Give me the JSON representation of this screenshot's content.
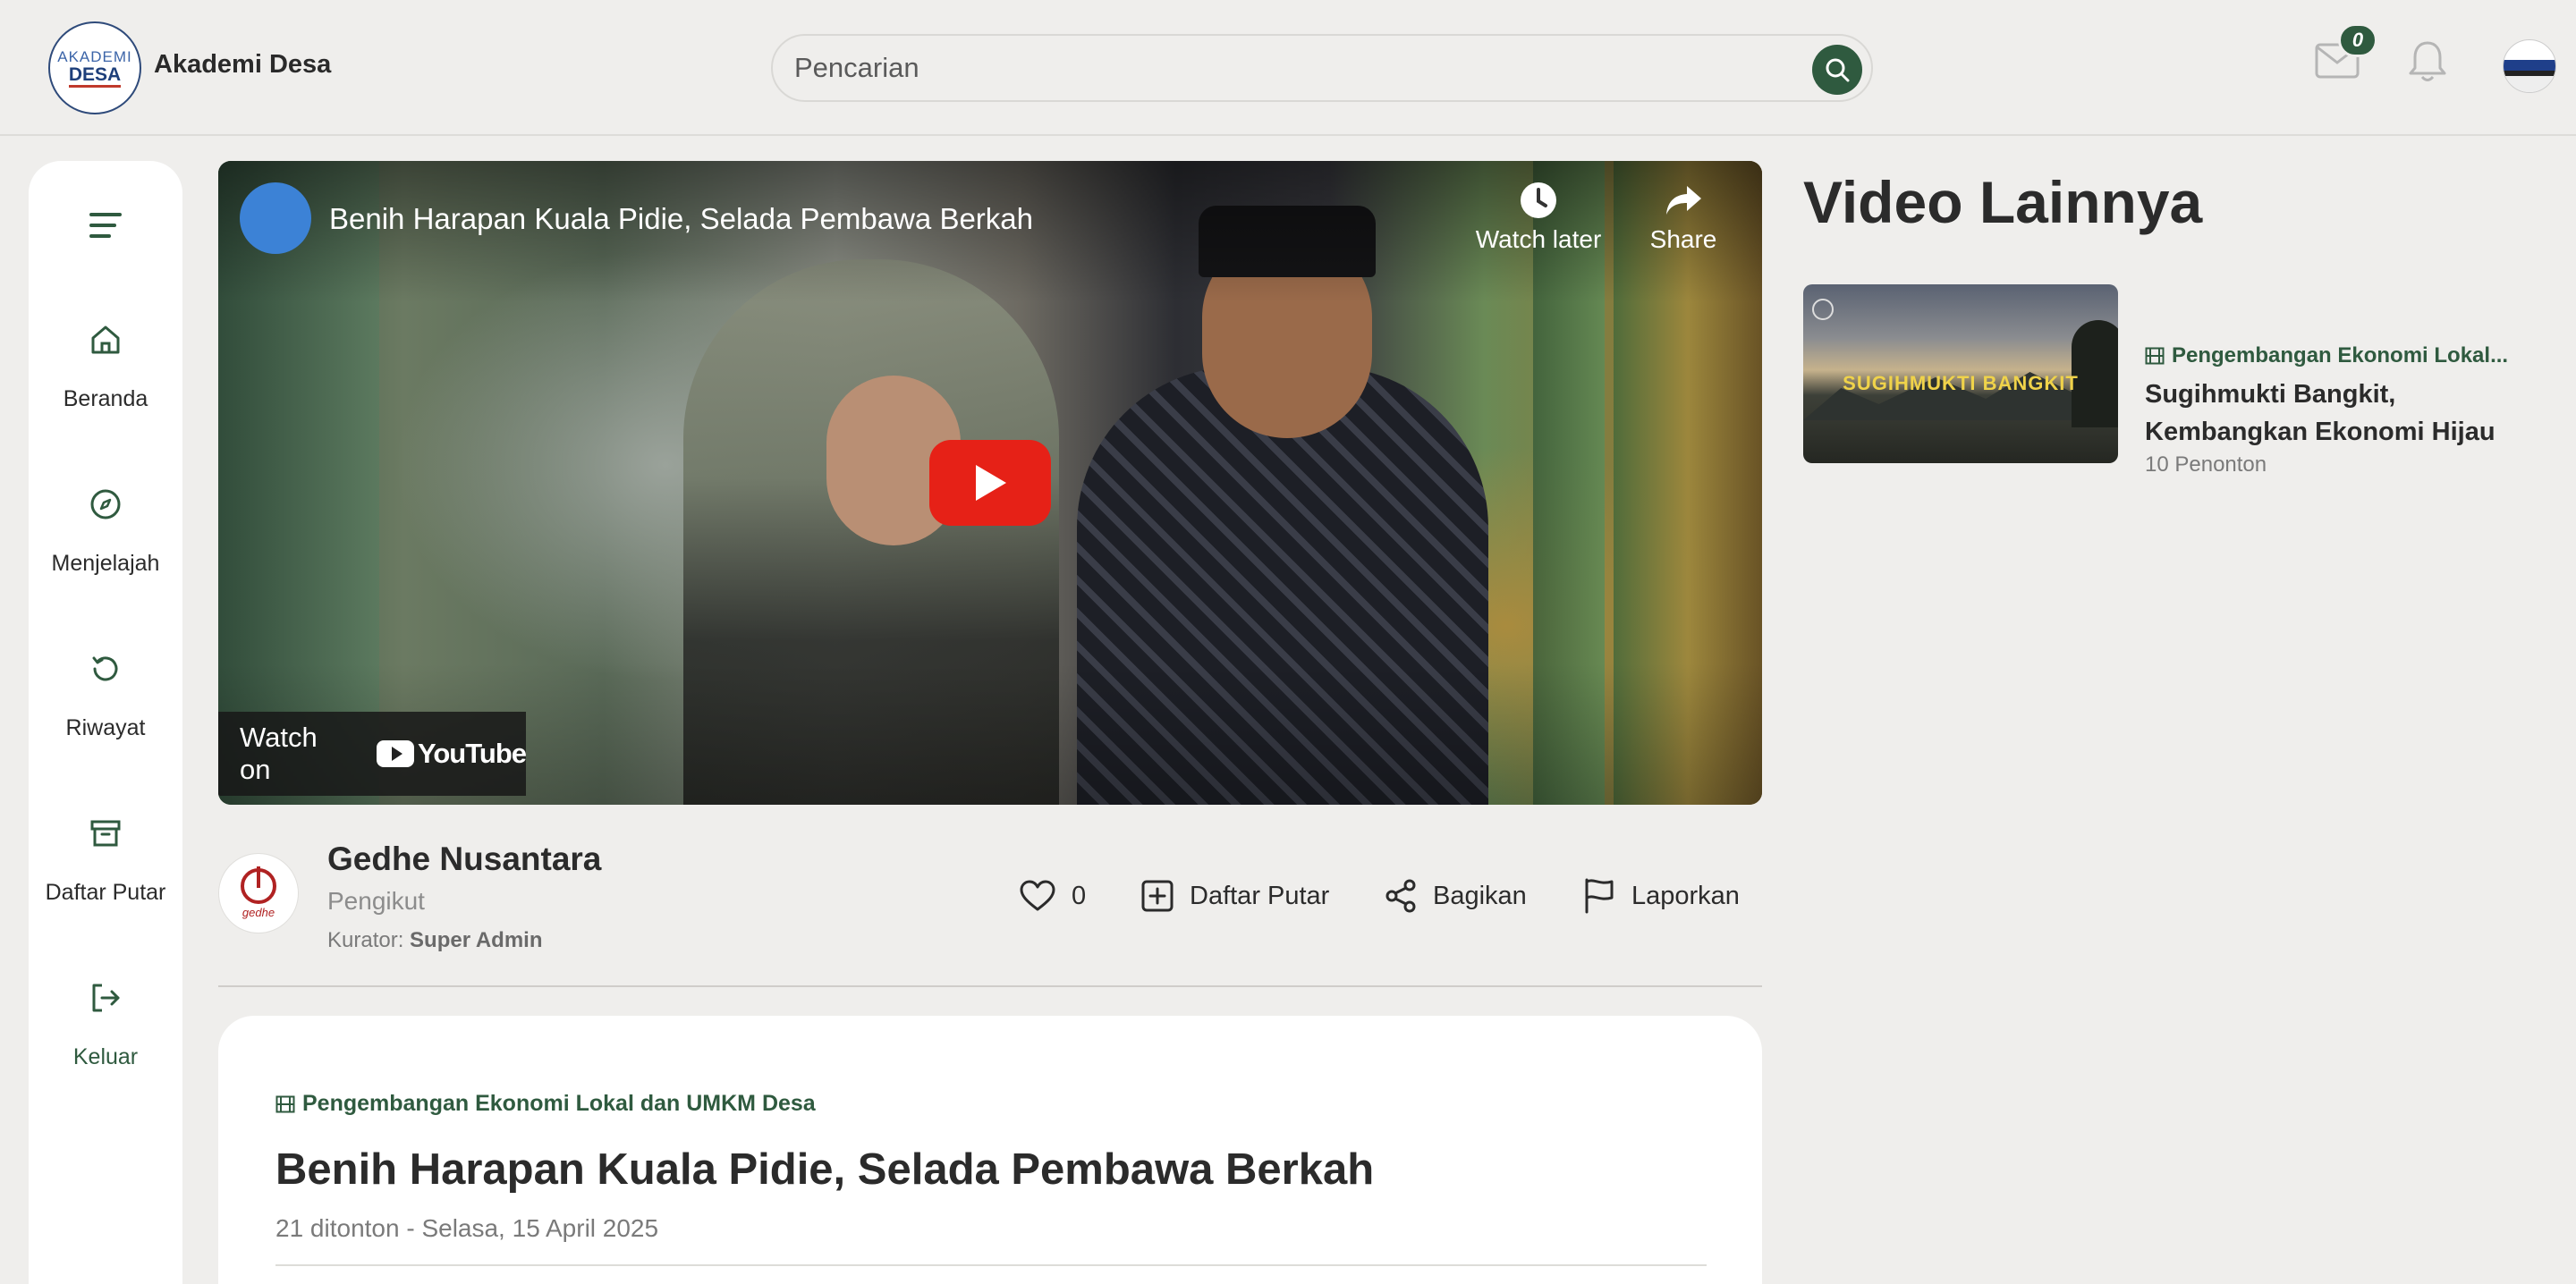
{
  "header": {
    "logo_line1": "AKADEMI",
    "logo_line2": "DESA",
    "brand": "Akademi Desa",
    "search_placeholder": "Pencarian",
    "mail_count": "0"
  },
  "sidebar": {
    "items": [
      {
        "label": "Beranda",
        "icon": "home-icon"
      },
      {
        "label": "Menjelajah",
        "icon": "compass-icon"
      },
      {
        "label": "Riwayat",
        "icon": "history-icon"
      },
      {
        "label": "Daftar Putar",
        "icon": "archive-icon"
      },
      {
        "label": "Keluar",
        "icon": "logout-icon"
      }
    ]
  },
  "video": {
    "title": "Benih Harapan Kuala Pidie, Selada Pembawa Berkah",
    "watch_later": "Watch later",
    "share": "Share",
    "watch_on": "Watch on",
    "youtube": "YouTube"
  },
  "channel": {
    "avatar_text": "gedhe",
    "name": "Gedhe Nusantara",
    "subtitle": "Pengikut",
    "curator_label": "Kurator:",
    "curator_name": "Super Admin"
  },
  "actions": {
    "likes": "0",
    "playlist": "Daftar Putar",
    "share": "Bagikan",
    "report": "Laporkan"
  },
  "info": {
    "category": "Pengembangan Ekonomi Lokal dan UMKM Desa",
    "title": "Benih Harapan Kuala Pidie, Selada Pembawa Berkah",
    "meta": "21 ditonton - Selasa, 15 April 2025"
  },
  "more_videos": {
    "heading": "Video Lainnya",
    "items": [
      {
        "thumb_text": "SUGIHMUKTI BANGKIT",
        "category": "Pengembangan Ekonomi Lokal...",
        "title": "Sugihmukti Bangkit, Kembangkan Ekonomi Hijau",
        "views": "10 Penonton"
      }
    ]
  },
  "colors": {
    "accent": "#2f5a3f",
    "background": "#efeeec",
    "youtube_red": "#e62117"
  }
}
